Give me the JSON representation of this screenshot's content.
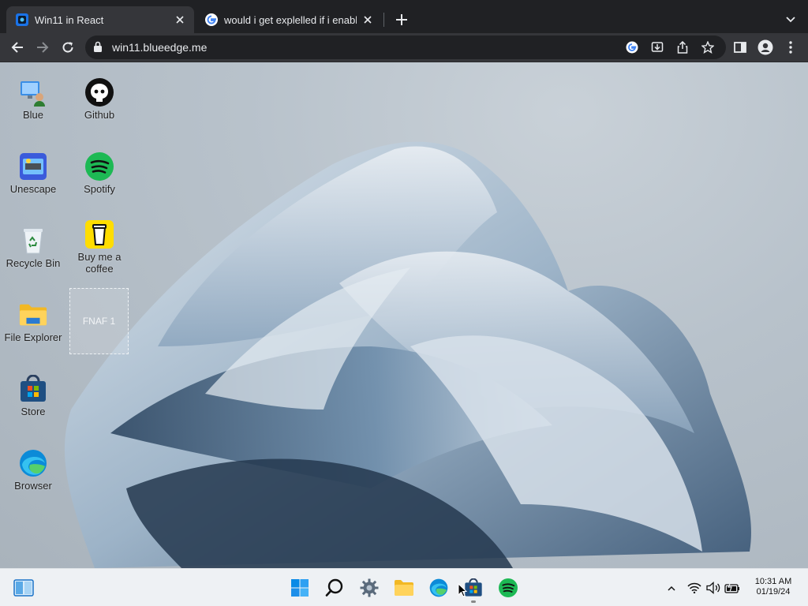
{
  "browser": {
    "tabs": [
      {
        "title": "Win11 in React",
        "active": true
      },
      {
        "title": "would i get explelled if i enable",
        "active": false
      }
    ],
    "url": "win11.blueedge.me"
  },
  "desktop": {
    "icons": [
      {
        "label": "Blue",
        "icon": "blue-app-icon"
      },
      {
        "label": "Unescape",
        "icon": "unescape-icon"
      },
      {
        "label": "Recycle Bin",
        "icon": "recycle-bin-icon"
      },
      {
        "label": "File Explorer",
        "icon": "folder-icon"
      },
      {
        "label": "Store",
        "icon": "store-icon"
      },
      {
        "label": "Browser",
        "icon": "edge-icon"
      },
      {
        "label": "Github",
        "icon": "github-icon"
      },
      {
        "label": "Spotify",
        "icon": "spotify-icon"
      },
      {
        "label": "Buy me a coffee",
        "icon": "coffee-cup-icon"
      },
      {
        "label": "FNAF 1",
        "icon": ""
      }
    ]
  },
  "taskbar": {
    "apps": [
      "widgets",
      "start",
      "search",
      "settings",
      "file-explorer",
      "edge",
      "store",
      "spotify"
    ],
    "clock": {
      "time": "10:31 AM",
      "date": "01/19/24"
    }
  },
  "colors": {
    "chrome_dark": "#202124",
    "chrome_toolbar": "#35363a",
    "taskbar": "#eef1f4",
    "win_blue": "#0078d4",
    "spotify_green": "#1db954"
  }
}
